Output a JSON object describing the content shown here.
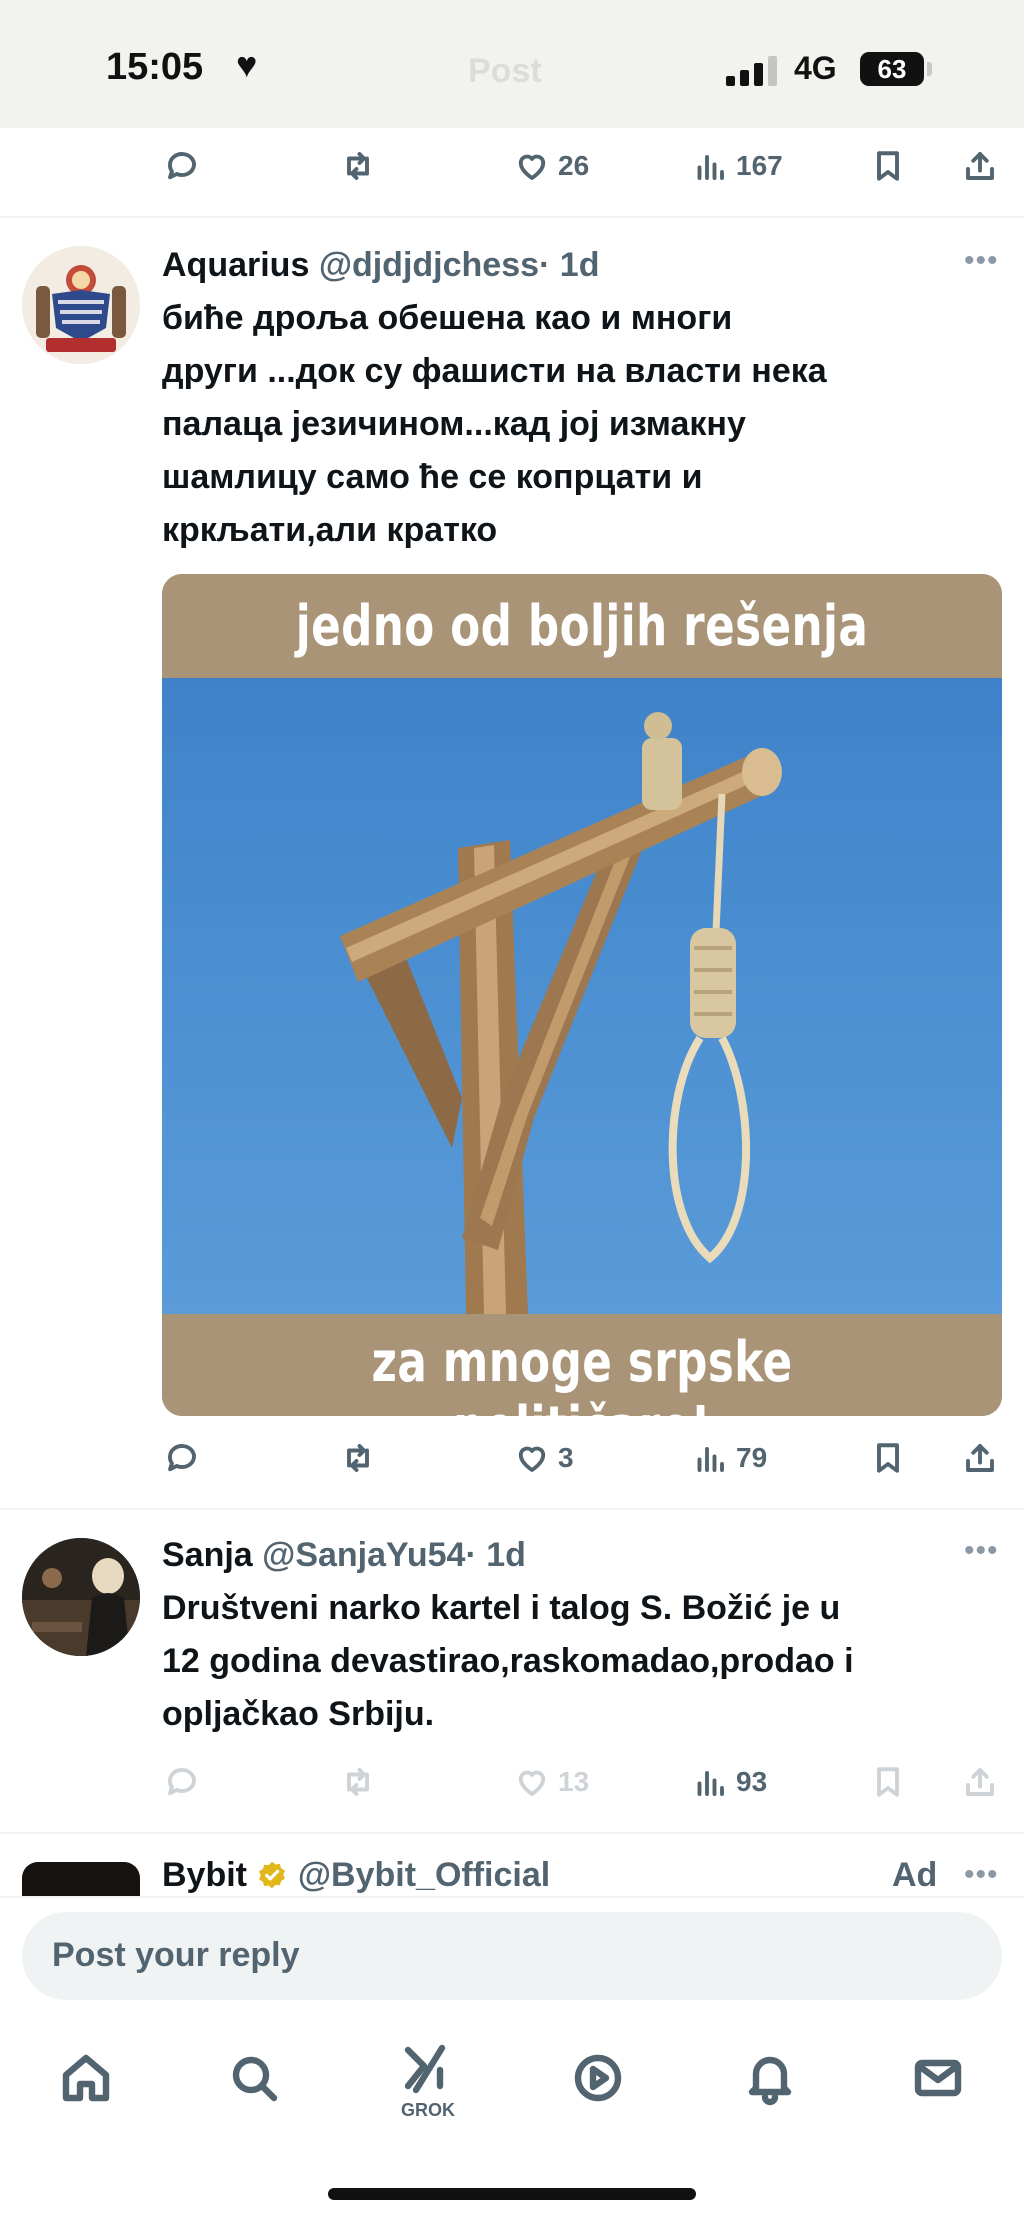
{
  "status_bar": {
    "time": "15:05",
    "network": "4G",
    "battery": "63",
    "faded_title": "Post"
  },
  "top_actions": {
    "likes": "26",
    "views": "167"
  },
  "tweets": [
    {
      "name": "Aquarius",
      "handle": "@djdjdjchess",
      "time": "· 1d",
      "text_lines": [
        "биће дроља обешена  као и многи",
        "други ...док су фашисти на власти нека",
        "палаца језичином...кад јој измакну",
        "шамлицу само ће се копрцати и",
        "кркљати,али кратко"
      ],
      "image_caption_top": "jedno od boljih rešenja",
      "image_caption_bottom": "za mnoge srpske političare!",
      "likes": "3",
      "views": "79"
    },
    {
      "name": "Sanja",
      "handle": "@SanjaYu54",
      "time": "· 1d",
      "text_lines": [
        "Društveni narko kartel i talog S. Božić je u",
        "12 godina devastirao,raskomadao,prodao i",
        "opljačkao Srbiju."
      ],
      "likes": "13",
      "views": "93"
    },
    {
      "name": "Bybit",
      "handle": "@Bybit_Official",
      "ad_label": "Ad"
    }
  ],
  "reply": {
    "placeholder": "Post your reply"
  },
  "nav": {
    "grok_label": "GROK"
  },
  "colors": {
    "text": "#0f1419",
    "secondary": "#536471",
    "verified": "#e2b719",
    "divider": "#eff3f4"
  }
}
